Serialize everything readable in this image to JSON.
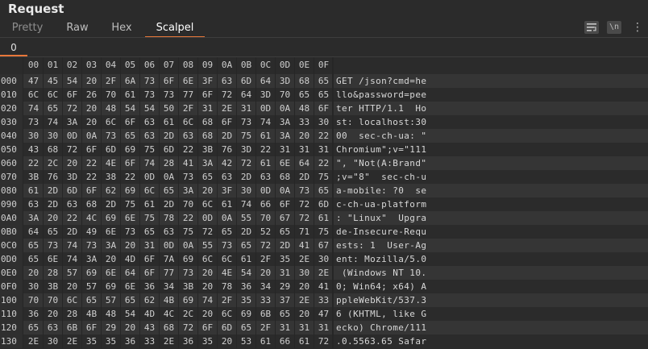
{
  "panel": {
    "title": "Request"
  },
  "tabs": [
    {
      "label": "Pretty"
    },
    {
      "label": "Raw"
    },
    {
      "label": "Hex"
    },
    {
      "label": "Scalpel"
    }
  ],
  "toolbar": {
    "wrap_icon": "wrap-lines-icon",
    "newline_label": "\\n",
    "menu_icon": "vertical-dots-icon"
  },
  "subtabs": [
    {
      "label": "0"
    }
  ],
  "hex_table": {
    "columns": [
      "00",
      "01",
      "02",
      "03",
      "04",
      "05",
      "06",
      "07",
      "08",
      "09",
      "0A",
      "0B",
      "0C",
      "0D",
      "0E",
      "0F"
    ],
    "rows": [
      {
        "offset": "000",
        "bytes": [
          "47",
          "45",
          "54",
          "20",
          "2F",
          "6A",
          "73",
          "6F",
          "6E",
          "3F",
          "63",
          "6D",
          "64",
          "3D",
          "68",
          "65"
        ],
        "ascii": "GET /json?cmd=he"
      },
      {
        "offset": "010",
        "bytes": [
          "6C",
          "6C",
          "6F",
          "26",
          "70",
          "61",
          "73",
          "73",
          "77",
          "6F",
          "72",
          "64",
          "3D",
          "70",
          "65",
          "65"
        ],
        "ascii": "llo&password=pee"
      },
      {
        "offset": "020",
        "bytes": [
          "74",
          "65",
          "72",
          "20",
          "48",
          "54",
          "54",
          "50",
          "2F",
          "31",
          "2E",
          "31",
          "0D",
          "0A",
          "48",
          "6F"
        ],
        "ascii": "ter HTTP/1.1  Ho"
      },
      {
        "offset": "030",
        "bytes": [
          "73",
          "74",
          "3A",
          "20",
          "6C",
          "6F",
          "63",
          "61",
          "6C",
          "68",
          "6F",
          "73",
          "74",
          "3A",
          "33",
          "30"
        ],
        "ascii": "st: localhost:30"
      },
      {
        "offset": "040",
        "bytes": [
          "30",
          "30",
          "0D",
          "0A",
          "73",
          "65",
          "63",
          "2D",
          "63",
          "68",
          "2D",
          "75",
          "61",
          "3A",
          "20",
          "22"
        ],
        "ascii": "00  sec-ch-ua: \""
      },
      {
        "offset": "050",
        "bytes": [
          "43",
          "68",
          "72",
          "6F",
          "6D",
          "69",
          "75",
          "6D",
          "22",
          "3B",
          "76",
          "3D",
          "22",
          "31",
          "31",
          "31"
        ],
        "ascii": "Chromium\";v=\"111"
      },
      {
        "offset": "060",
        "bytes": [
          "22",
          "2C",
          "20",
          "22",
          "4E",
          "6F",
          "74",
          "28",
          "41",
          "3A",
          "42",
          "72",
          "61",
          "6E",
          "64",
          "22"
        ],
        "ascii": "\", \"Not(A:Brand\""
      },
      {
        "offset": "070",
        "bytes": [
          "3B",
          "76",
          "3D",
          "22",
          "38",
          "22",
          "0D",
          "0A",
          "73",
          "65",
          "63",
          "2D",
          "63",
          "68",
          "2D",
          "75"
        ],
        "ascii": ";v=\"8\"  sec-ch-u"
      },
      {
        "offset": "080",
        "bytes": [
          "61",
          "2D",
          "6D",
          "6F",
          "62",
          "69",
          "6C",
          "65",
          "3A",
          "20",
          "3F",
          "30",
          "0D",
          "0A",
          "73",
          "65"
        ],
        "ascii": "a-mobile: ?0  se"
      },
      {
        "offset": "090",
        "bytes": [
          "63",
          "2D",
          "63",
          "68",
          "2D",
          "75",
          "61",
          "2D",
          "70",
          "6C",
          "61",
          "74",
          "66",
          "6F",
          "72",
          "6D"
        ],
        "ascii": "c-ch-ua-platform"
      },
      {
        "offset": "0A0",
        "bytes": [
          "3A",
          "20",
          "22",
          "4C",
          "69",
          "6E",
          "75",
          "78",
          "22",
          "0D",
          "0A",
          "55",
          "70",
          "67",
          "72",
          "61"
        ],
        "ascii": ": \"Linux\"  Upgra"
      },
      {
        "offset": "0B0",
        "bytes": [
          "64",
          "65",
          "2D",
          "49",
          "6E",
          "73",
          "65",
          "63",
          "75",
          "72",
          "65",
          "2D",
          "52",
          "65",
          "71",
          "75"
        ],
        "ascii": "de-Insecure-Requ"
      },
      {
        "offset": "0C0",
        "bytes": [
          "65",
          "73",
          "74",
          "73",
          "3A",
          "20",
          "31",
          "0D",
          "0A",
          "55",
          "73",
          "65",
          "72",
          "2D",
          "41",
          "67"
        ],
        "ascii": "ests: 1  User-Ag"
      },
      {
        "offset": "0D0",
        "bytes": [
          "65",
          "6E",
          "74",
          "3A",
          "20",
          "4D",
          "6F",
          "7A",
          "69",
          "6C",
          "6C",
          "61",
          "2F",
          "35",
          "2E",
          "30"
        ],
        "ascii": "ent: Mozilla/5.0"
      },
      {
        "offset": "0E0",
        "bytes": [
          "20",
          "28",
          "57",
          "69",
          "6E",
          "64",
          "6F",
          "77",
          "73",
          "20",
          "4E",
          "54",
          "20",
          "31",
          "30",
          "2E"
        ],
        "ascii": " (Windows NT 10."
      },
      {
        "offset": "0F0",
        "bytes": [
          "30",
          "3B",
          "20",
          "57",
          "69",
          "6E",
          "36",
          "34",
          "3B",
          "20",
          "78",
          "36",
          "34",
          "29",
          "20",
          "41"
        ],
        "ascii": "0; Win64; x64) A"
      },
      {
        "offset": "100",
        "bytes": [
          "70",
          "70",
          "6C",
          "65",
          "57",
          "65",
          "62",
          "4B",
          "69",
          "74",
          "2F",
          "35",
          "33",
          "37",
          "2E",
          "33"
        ],
        "ascii": "ppleWebKit/537.3"
      },
      {
        "offset": "110",
        "bytes": [
          "36",
          "20",
          "28",
          "4B",
          "48",
          "54",
          "4D",
          "4C",
          "2C",
          "20",
          "6C",
          "69",
          "6B",
          "65",
          "20",
          "47"
        ],
        "ascii": "6 (KHTML, like G"
      },
      {
        "offset": "120",
        "bytes": [
          "65",
          "63",
          "6B",
          "6F",
          "29",
          "20",
          "43",
          "68",
          "72",
          "6F",
          "6D",
          "65",
          "2F",
          "31",
          "31",
          "31"
        ],
        "ascii": "ecko) Chrome/111"
      },
      {
        "offset": "130",
        "bytes": [
          "2E",
          "30",
          "2E",
          "35",
          "35",
          "36",
          "33",
          "2E",
          "36",
          "35",
          "20",
          "53",
          "61",
          "66",
          "61",
          "72"
        ],
        "ascii": ".0.5563.65 Safar"
      }
    ]
  }
}
